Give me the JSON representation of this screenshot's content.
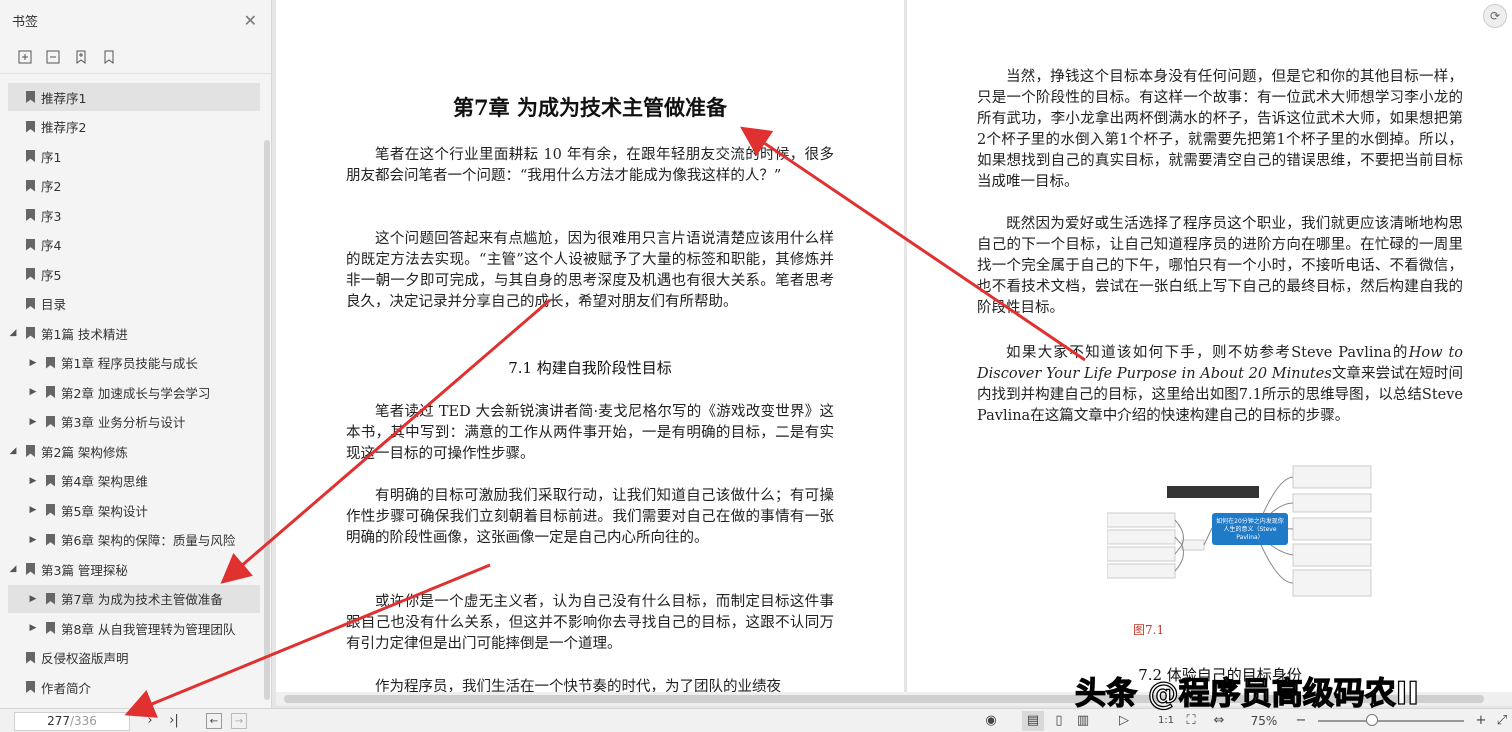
{
  "sidebar": {
    "title": "书签",
    "items": [
      {
        "label": "推荐序1",
        "caret": "",
        "indent": 0,
        "selected": true
      },
      {
        "label": "推荐序2",
        "caret": "",
        "indent": 0,
        "selected": false
      },
      {
        "label": "序1",
        "caret": "",
        "indent": 0,
        "selected": false
      },
      {
        "label": "序2",
        "caret": "",
        "indent": 0,
        "selected": false
      },
      {
        "label": "序3",
        "caret": "",
        "indent": 0,
        "selected": false
      },
      {
        "label": "序4",
        "caret": "",
        "indent": 0,
        "selected": false
      },
      {
        "label": "序5",
        "caret": "",
        "indent": 0,
        "selected": false
      },
      {
        "label": "目录",
        "caret": "",
        "indent": 0,
        "selected": false
      },
      {
        "label": "第1篇 技术精进",
        "caret": "◢",
        "indent": 0,
        "selected": false
      },
      {
        "label": "第1章 程序员技能与成长",
        "caret": "▶",
        "indent": 1,
        "selected": false
      },
      {
        "label": "第2章 加速成长与学会学习",
        "caret": "▶",
        "indent": 1,
        "selected": false
      },
      {
        "label": "第3章 业务分析与设计",
        "caret": "▶",
        "indent": 1,
        "selected": false
      },
      {
        "label": "第2篇 架构修炼",
        "caret": "◢",
        "indent": 0,
        "selected": false
      },
      {
        "label": "第4章 架构思维",
        "caret": "▶",
        "indent": 1,
        "selected": false
      },
      {
        "label": "第5章 架构设计",
        "caret": "▶",
        "indent": 1,
        "selected": false
      },
      {
        "label": "第6章 架构的保障：质量与风险",
        "caret": "▶",
        "indent": 1,
        "selected": false
      },
      {
        "label": "第3篇 管理探秘",
        "caret": "◢",
        "indent": 0,
        "selected": false
      },
      {
        "label": "第7章 为成为技术主管做准备",
        "caret": "▶",
        "indent": 1,
        "selected": true
      },
      {
        "label": "第8章 从自我管理转为管理团队",
        "caret": "▶",
        "indent": 1,
        "selected": false
      },
      {
        "label": "反侵权盗版声明",
        "caret": "",
        "indent": 0,
        "selected": false
      },
      {
        "label": "作者简介",
        "caret": "",
        "indent": 0,
        "selected": false
      }
    ]
  },
  "pager": {
    "current": "277",
    "total": "/336",
    "zoom": "75%"
  },
  "document": {
    "left": {
      "chapter_title": "第7章  为成为技术主管做准备",
      "p1": "笔者在这个行业里面耕耘 10 年有余，在跟年轻朋友交流的时候，很多朋友都会问笔者一个问题：“我用什么方法才能成为像我这样的人？”",
      "p2": "这个问题回答起来有点尴尬，因为很难用只言片语说清楚应该用什么样的既定方法去实现。“主管”这个人设被赋予了大量的标签和职能，其修炼并非一朝一夕即可完成，与其自身的思考深度及机遇也有很大关系。笔者思考良久，决定记录并分享自己的成长，希望对朋友们有所帮助。",
      "section_71": "7.1  构建自我阶段性目标",
      "p3": "笔者读过 TED 大会新锐演讲者简·麦戈尼格尔写的《游戏改变世界》这本书，其中写到：满意的工作从两件事开始，一是有明确的目标，二是有实现这一目标的可操作性步骤。",
      "p4": "有明确的目标可激励我们采取行动，让我们知道自己该做什么；有可操作性步骤可确保我们立刻朝着目标前进。我们需要对自己在做的事情有一张明确的阶段性画像，这张画像一定是自己内心所向往的。",
      "p5": "或许你是一个虚无主义者，认为自己没有什么目标，而制定目标这件事跟自己也没有什么关系，但这并不影响你去寻找自己的目标，这跟不认同万有引力定律但是出门可能摔倒是一个道理。",
      "p6": "作为程序员，我们生活在一个快节奏的时代，为了团队的业绩夜"
    },
    "right": {
      "p1": "当然，挣钱这个目标本身没有任何问题，但是它和你的其他目标一样，只是一个阶段性的目标。有这样一个故事：有一位武术大师想学习李小龙的所有武功，李小龙拿出两杯倒满水的杯子，告诉这位武术大师，如果想把第2个杯子里的水倒入第1个杯子，就需要先把第1个杯子里的水倒掉。所以，如果想找到自己的真实目标，就需要清空自己的错误思维，不要把当前目标当成唯一目标。",
      "p2": "既然因为爱好或生活选择了程序员这个职业，我们就更应该清晰地构思自己的下一个目标，让自己知道程序员的进阶方向在哪里。在忙碌的一周里找一个完全属于自己的下午，哪怕只有一个小时，不接听电话、不看微信，也不看技术文档，尝试在一张白纸上写下自己的最终目标，然后构建自我的阶段性目标。",
      "p3_a": "如果大家不知道该如何下手，则不妨参考Steve Pavlina的",
      "p3_b": "How to Discover Your Life Purpose in About 20 Minutes",
      "p3_c": "文章来尝试在短时间内找到并构建自己的目标，这里给出如图7.1所示的思维导图，以总结Steve Pavlina在这篇文章中介绍的快速构建自己的目标的步骤。",
      "mindmap_center": "如何在20分钟之内发现你人生的意义（Steve Pavlina）",
      "fig_caption": "图7.1",
      "section_72": "7.2  体验自己的目标身份"
    }
  },
  "watermark": "头条 @程序员高级码农II",
  "colors": {
    "arrow": "#e03030",
    "mindmap_center": "#1f7ac7"
  }
}
